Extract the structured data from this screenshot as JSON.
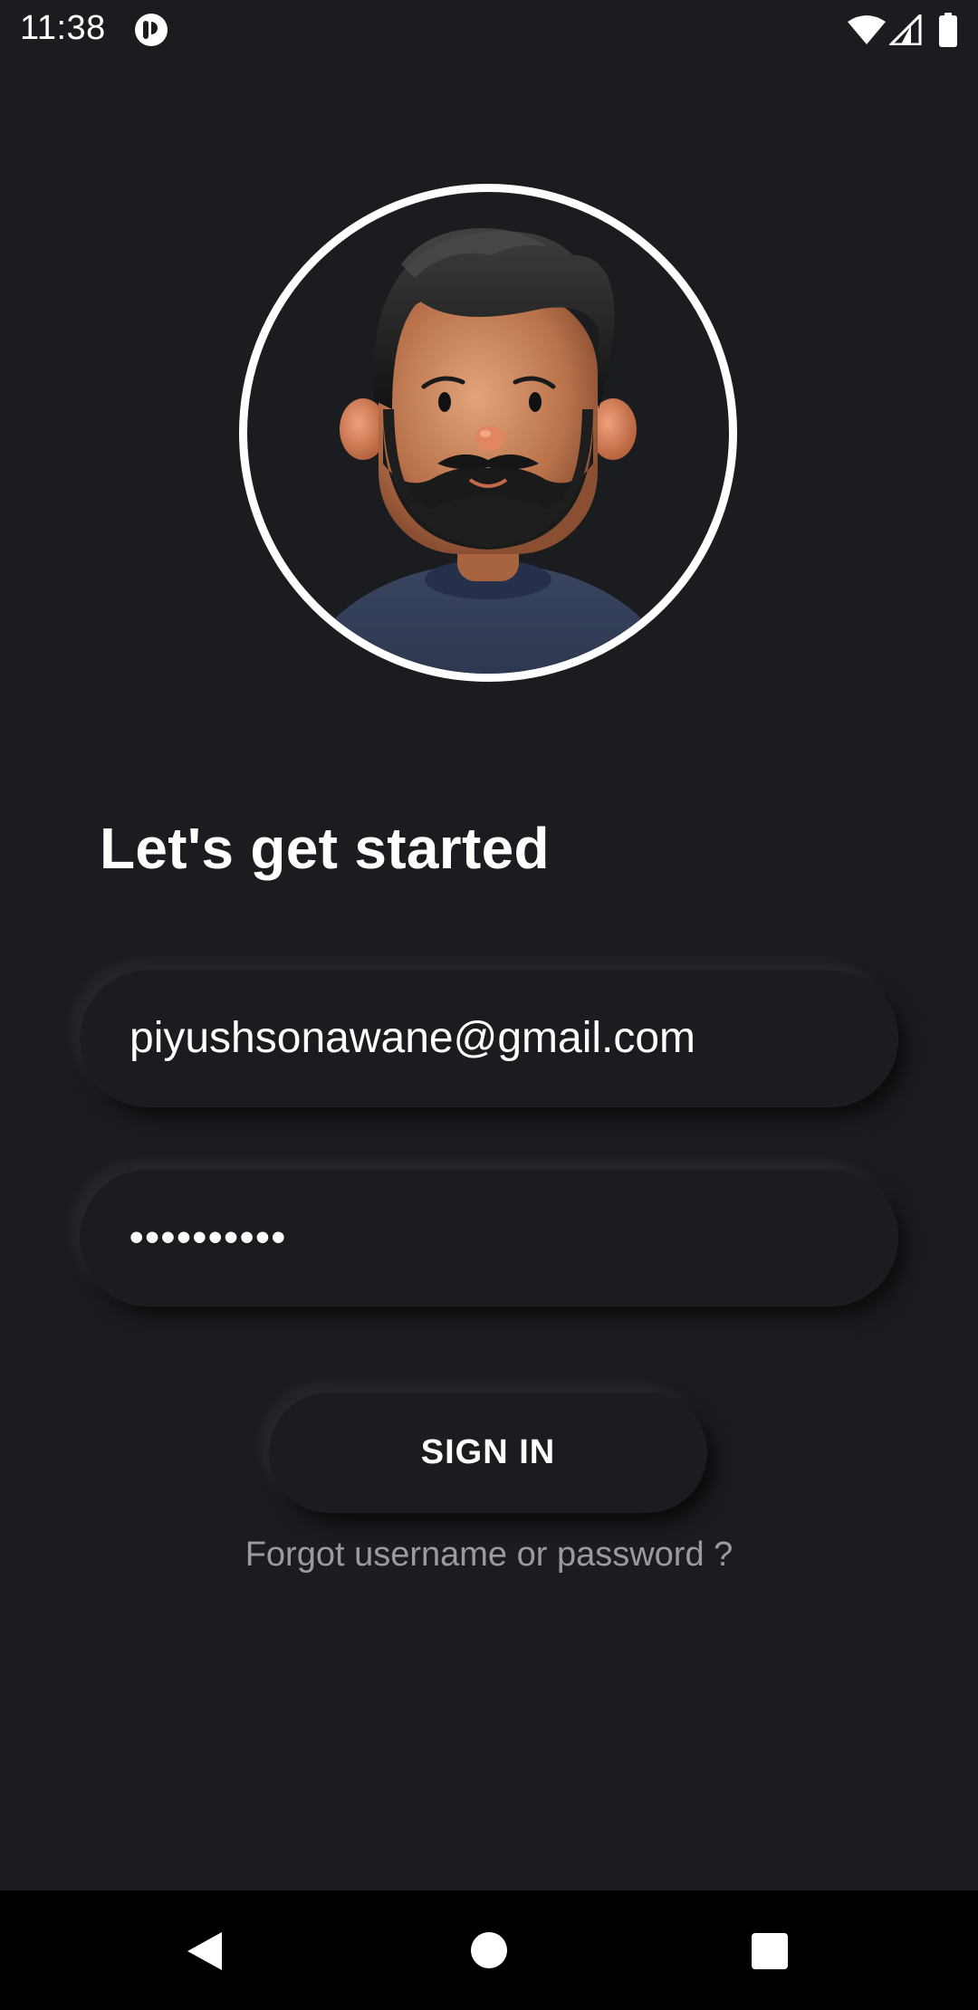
{
  "status_bar": {
    "time": "11:38",
    "app_icon": "notification-app-icon",
    "wifi_icon": "wifi-icon",
    "signal_icon": "cell-signal-icon",
    "battery_icon": "battery-icon"
  },
  "avatar": {
    "icon": "bearded-man-avatar"
  },
  "login": {
    "heading": "Let's get started",
    "email_value": "piyushsonawane@gmail.com",
    "password_value": "••••••••••",
    "sign_in_label": "SIGN IN",
    "forgot_label": "Forgot username or password ?"
  },
  "nav_bar": {
    "back_icon": "back-triangle-icon",
    "home_icon": "home-circle-icon",
    "recents_icon": "recents-square-icon"
  },
  "colors": {
    "background": "#1b1c20",
    "text": "#ffffff",
    "muted_text": "#9a9ba0",
    "nav_bar": "#000000"
  }
}
